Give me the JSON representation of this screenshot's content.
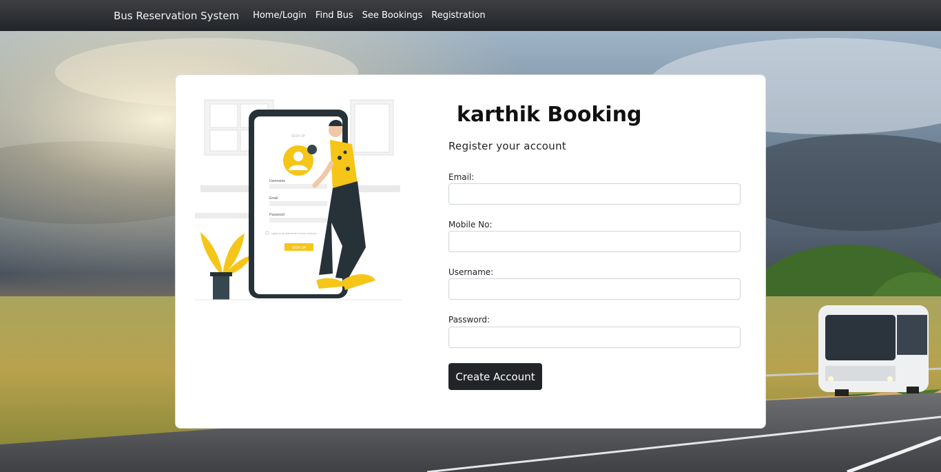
{
  "navbar": {
    "brand": "Bus Reservation System",
    "links": [
      "Home/Login",
      "Find Bus",
      "See Bookings",
      "Registration"
    ]
  },
  "card": {
    "title": "karthik Booking",
    "subtitle": "Register your account",
    "fields": [
      {
        "label": "Email:",
        "value": ""
      },
      {
        "label": "Mobile No:",
        "value": ""
      },
      {
        "label": "Username:",
        "value": ""
      },
      {
        "label": "Password:",
        "value": ""
      }
    ],
    "submit_label": "Create Account"
  },
  "illustration": {
    "screen_title": "SIGN UP",
    "username_label": "Username",
    "email_label": "Email",
    "password_label": "Password",
    "terms_text": "I agree to all statements in terms of service",
    "button_label": "SIGN UP"
  },
  "colors": {
    "navbar": "#212529",
    "button": "#212529",
    "accent_yellow": "#f5c518",
    "card": "#ffffff"
  }
}
